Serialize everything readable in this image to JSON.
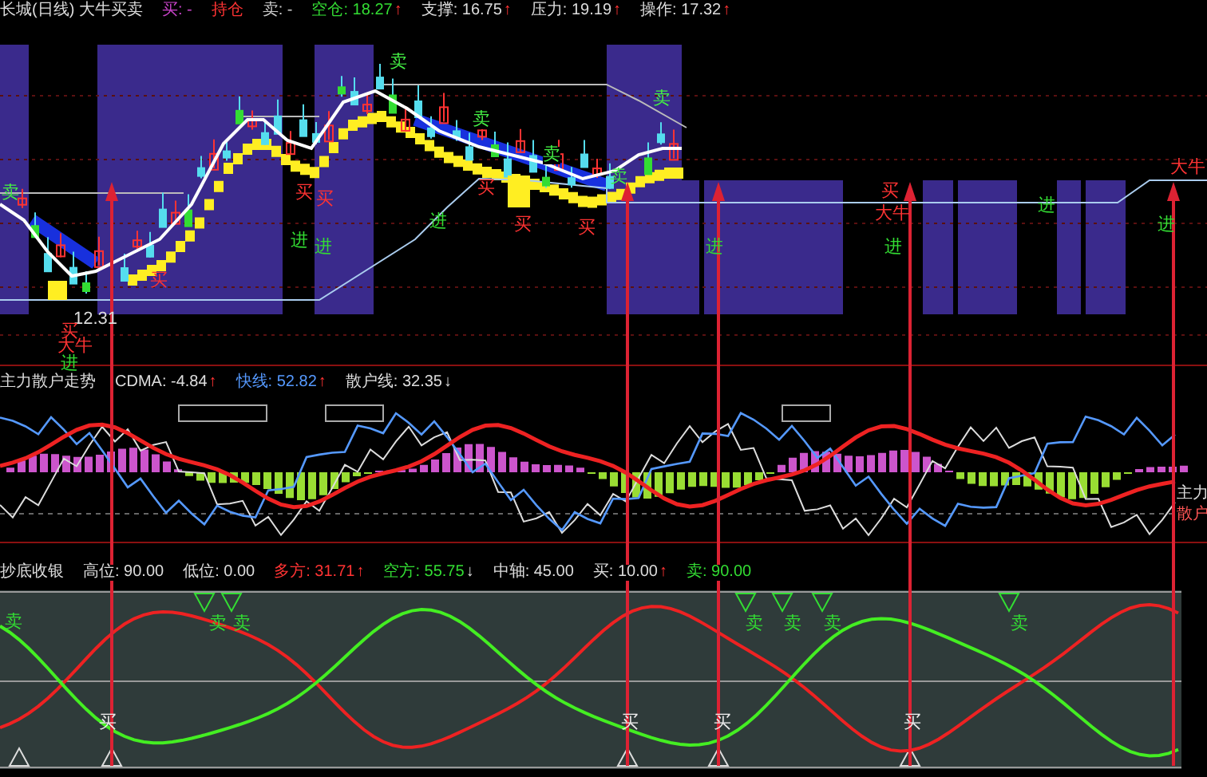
{
  "price_panel": {
    "title": "长城(日线) 大牛买卖",
    "indicators": [
      {
        "text": "买: -",
        "color": "#cc44cc"
      },
      {
        "text": "持仓",
        "color": "#ff3333"
      },
      {
        "text": "卖: -",
        "color": "#cccccc"
      },
      {
        "text": "空仓: 18.27",
        "color": "#33dd33",
        "arrow": "↑"
      },
      {
        "text": "支撑: 16.75",
        "color": "#dddddd",
        "arrow": "↑"
      },
      {
        "text": "压力: 19.19",
        "color": "#dddddd",
        "arrow": "↑"
      },
      {
        "text": "操作: 17.32",
        "color": "#dddddd",
        "arrow": "↑"
      }
    ],
    "signals": [
      {
        "text": "卖",
        "kind": "sell"
      },
      {
        "text": "买",
        "kind": "buy"
      },
      {
        "text": "进",
        "kind": "enter"
      },
      {
        "text": "进",
        "kind": "enter"
      },
      {
        "text": "买",
        "kind": "buy"
      },
      {
        "text": "买",
        "kind": "buy"
      },
      {
        "text": "卖",
        "kind": "sell"
      },
      {
        "text": "进",
        "kind": "enter"
      },
      {
        "text": "卖",
        "kind": "sell"
      },
      {
        "text": "买",
        "kind": "buy"
      },
      {
        "text": "买",
        "kind": "buy"
      },
      {
        "text": "卖",
        "kind": "sell"
      },
      {
        "text": "卖",
        "kind": "sell"
      },
      {
        "text": "买",
        "kind": "buy"
      },
      {
        "text": "卖",
        "kind": "sell"
      },
      {
        "text": "12.31",
        "kind": "price"
      },
      {
        "text": "买",
        "kind": "buy"
      },
      {
        "text": "大牛",
        "kind": "bull"
      },
      {
        "text": "进",
        "kind": "enter"
      },
      {
        "text": "进",
        "kind": "enter"
      },
      {
        "text": "买",
        "kind": "buy"
      },
      {
        "text": "大牛",
        "kind": "bull"
      },
      {
        "text": "进",
        "kind": "enter"
      },
      {
        "text": "进",
        "kind": "enter"
      },
      {
        "text": "大牛",
        "kind": "bull"
      },
      {
        "text": "进",
        "kind": "enter"
      }
    ]
  },
  "flow_panel": {
    "title": "主力散户走势",
    "indicators": [
      {
        "text": "CDMA: -4.84",
        "color": "#dddddd",
        "arrow": "↑"
      },
      {
        "text": "快线: 52.82",
        "color": "#5599ff",
        "arrow": "↑"
      },
      {
        "text": "散户线: 32.35",
        "color": "#dddddd",
        "arrow": "↓"
      }
    ],
    "edge_labels": [
      {
        "text": "主力",
        "kind": "main"
      },
      {
        "text": "散户",
        "kind": "retail"
      }
    ]
  },
  "bottom_panel": {
    "title": "抄底收银",
    "indicators": [
      {
        "text": "高位: 90.00",
        "color": "#dddddd"
      },
      {
        "text": "低位: 0.00",
        "color": "#dddddd"
      },
      {
        "text": "多方: 31.71",
        "color": "#ff3333",
        "arrow": "↑"
      },
      {
        "text": "空方: 55.75",
        "color": "#33dd33",
        "arrow": "↓"
      },
      {
        "text": "中轴: 45.00",
        "color": "#dddddd"
      },
      {
        "text": "买: 10.00",
        "color": "#dddddd",
        "arrow": "↑"
      },
      {
        "text": "卖: 90.00",
        "color": "#33dd33"
      }
    ],
    "signals": [
      {
        "text": "卖",
        "kind": "sell"
      },
      {
        "text": "卖",
        "kind": "sell"
      },
      {
        "text": "卖",
        "kind": "sell"
      },
      {
        "text": "卖",
        "kind": "sell"
      },
      {
        "text": "卖",
        "kind": "sell"
      },
      {
        "text": "卖",
        "kind": "sell"
      },
      {
        "text": "卖",
        "kind": "sell"
      },
      {
        "text": "买",
        "kind": "buy"
      },
      {
        "text": "买",
        "kind": "buy"
      },
      {
        "text": "买",
        "kind": "buy"
      },
      {
        "text": "买",
        "kind": "buy"
      }
    ]
  }
}
